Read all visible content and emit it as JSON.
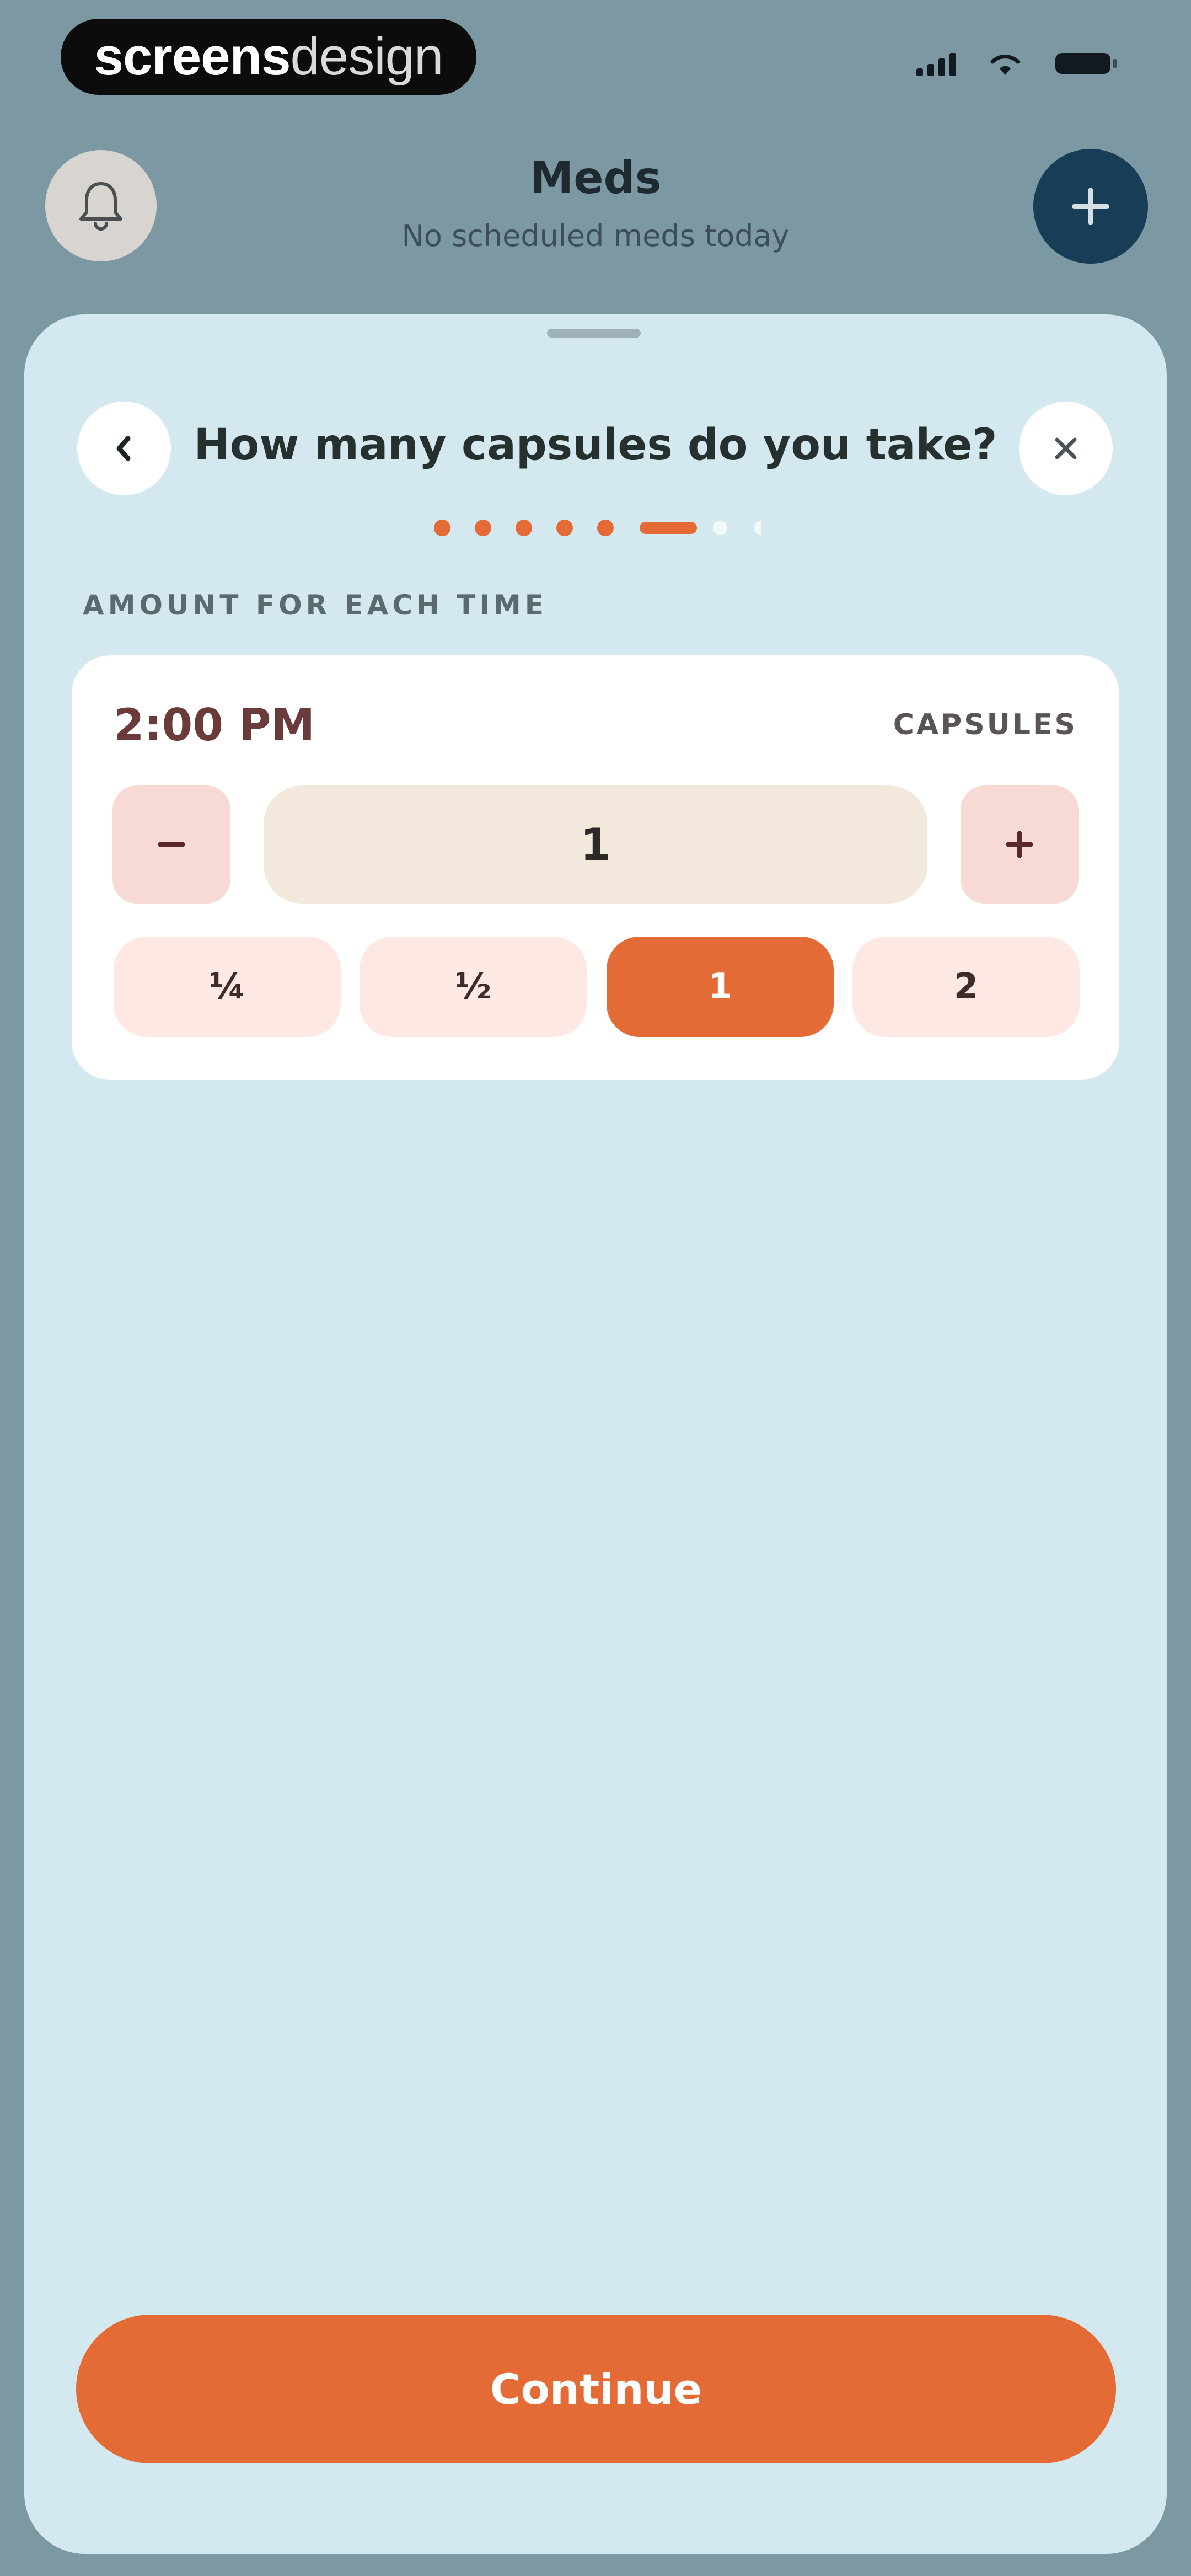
{
  "status_bar": {
    "brand_strong": "screens",
    "brand_light": "design"
  },
  "header": {
    "title": "Meds",
    "subtitle": "No scheduled meds today"
  },
  "sheet": {
    "question": "How many capsules do you take?",
    "progress": {
      "total_steps": 8,
      "current_step": 6
    },
    "section_label": "AMOUNT FOR EACH TIME",
    "dose": {
      "time": "2:00 PM",
      "unit": "CAPSULES",
      "amount": "1",
      "presets": [
        "¼",
        "½",
        "1",
        "2"
      ],
      "selected_preset": "1"
    },
    "continue_label": "Continue"
  },
  "colors": {
    "accent": "#e46a36",
    "sheet_bg": "#d3e9ef",
    "add_button": "#173d57",
    "chip_bg": "#fde8e3",
    "stepper_bg": "#f8dad4",
    "field_bg": "#f2e8dc"
  },
  "icons": {
    "bell": "bell-icon",
    "add": "plus-icon",
    "back": "chevron-left-icon",
    "close": "close-icon",
    "minus": "minus-icon",
    "plus": "plus-icon"
  }
}
